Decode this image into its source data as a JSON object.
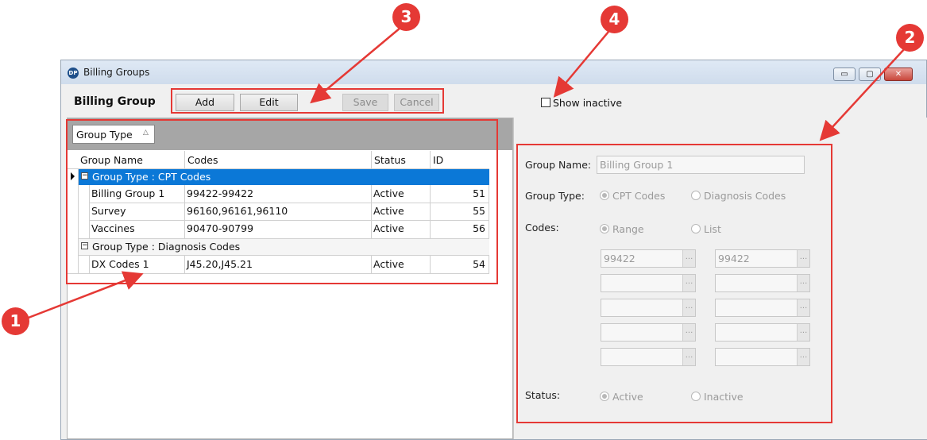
{
  "window": {
    "title": "Billing Groups",
    "app_icon": "dp-logo-icon",
    "controls": {
      "minimize": "▭",
      "maximize": "▢",
      "close": "✕"
    }
  },
  "toolbar": {
    "section_title": "Billing Group",
    "add_label": "Add",
    "edit_label": "Edit",
    "save_label": "Save",
    "cancel_label": "Cancel",
    "show_inactive_label": "Show inactive",
    "show_inactive_checked": false
  },
  "grid": {
    "group_by_chip": "Group Type",
    "sort_icon": "triangle-up-icon",
    "columns": [
      "Group Name",
      "Codes",
      "Status",
      "ID"
    ],
    "groups": [
      {
        "label": "Group Type : CPT Codes",
        "selected": true,
        "rows": [
          {
            "name": "Billing Group 1",
            "codes": "99422-99422",
            "status": "Active",
            "id": "51"
          },
          {
            "name": "Survey",
            "codes": "96160,96161,96110",
            "status": "Active",
            "id": "55"
          },
          {
            "name": "Vaccines",
            "codes": "90470-90799",
            "status": "Active",
            "id": "56"
          }
        ]
      },
      {
        "label": "Group Type : Diagnosis Codes",
        "selected": false,
        "rows": [
          {
            "name": "DX Codes 1",
            "codes": "J45.20,J45.21",
            "status": "Active",
            "id": "54"
          }
        ]
      }
    ]
  },
  "detail": {
    "group_name_label": "Group Name:",
    "group_name_value": "Billing Group 1",
    "group_type_label": "Group Type:",
    "group_type_options": [
      "CPT Codes",
      "Diagnosis Codes"
    ],
    "group_type_selected": "CPT Codes",
    "codes_label": "Codes:",
    "codes_options": [
      "Range",
      "List"
    ],
    "codes_selected": "Range",
    "range_from": [
      "99422",
      "",
      "",
      "",
      ""
    ],
    "range_to": [
      "99422",
      "",
      "",
      "",
      ""
    ],
    "ellipsis": "...",
    "status_label": "Status:",
    "status_options": [
      "Active",
      "Inactive"
    ],
    "status_selected": "Active"
  },
  "annotations": {
    "badges": [
      "1",
      "2",
      "3",
      "4"
    ],
    "color": "#e53935"
  },
  "colors": {
    "selection": "#0b78d7",
    "group_bar": "#a6a6a6",
    "accent_red": "#e53935"
  }
}
